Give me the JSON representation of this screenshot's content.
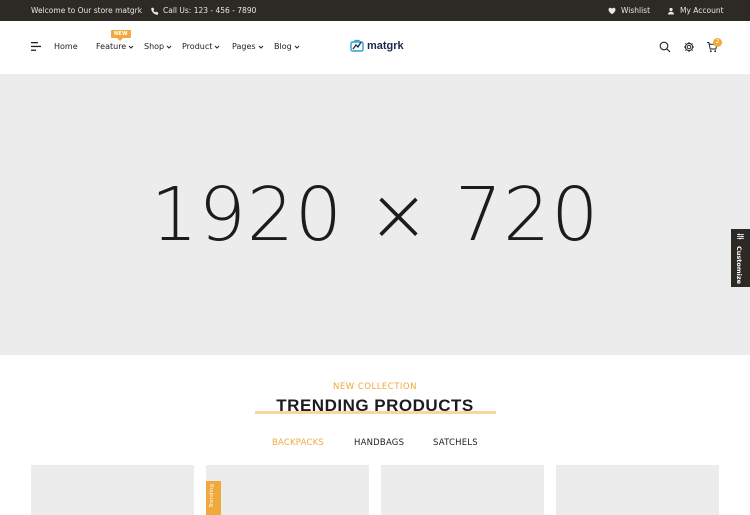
{
  "topbar": {
    "welcome": "Welcome to Our store matgrk",
    "call": "Call Us: 123 - 456 - 7890",
    "wishlist": "Wishlist",
    "account": "My Account"
  },
  "header": {
    "new_badge": "NEW",
    "nav": [
      "Home",
      "Feature",
      "Shop",
      "Product",
      "Pages",
      "Blog"
    ],
    "logo": "matgrk",
    "cart_count": "2"
  },
  "hero": {
    "placeholder": "1920 × 720"
  },
  "customize": {
    "label": "Customize"
  },
  "section": {
    "kicker": "NEW COLLECTION",
    "title": "TRENDING PRODUCTS",
    "tabs": [
      "BACKPACKS",
      "HANDBAGS",
      "SATCHELS"
    ]
  },
  "cards": {
    "trend_badge": "Trending"
  },
  "colors": {
    "accent": "#f0a93b",
    "topbar_bg": "#2d2a26",
    "placeholder_bg": "#ececec"
  },
  "icons": {
    "menu": "hamburger-icon",
    "phone": "phone-icon",
    "heart": "heart-icon",
    "user": "user-icon",
    "search": "search-icon",
    "settings": "gear-icon",
    "cart": "cart-icon",
    "chevron": "chevron-down-icon",
    "customize": "sliders-icon"
  }
}
